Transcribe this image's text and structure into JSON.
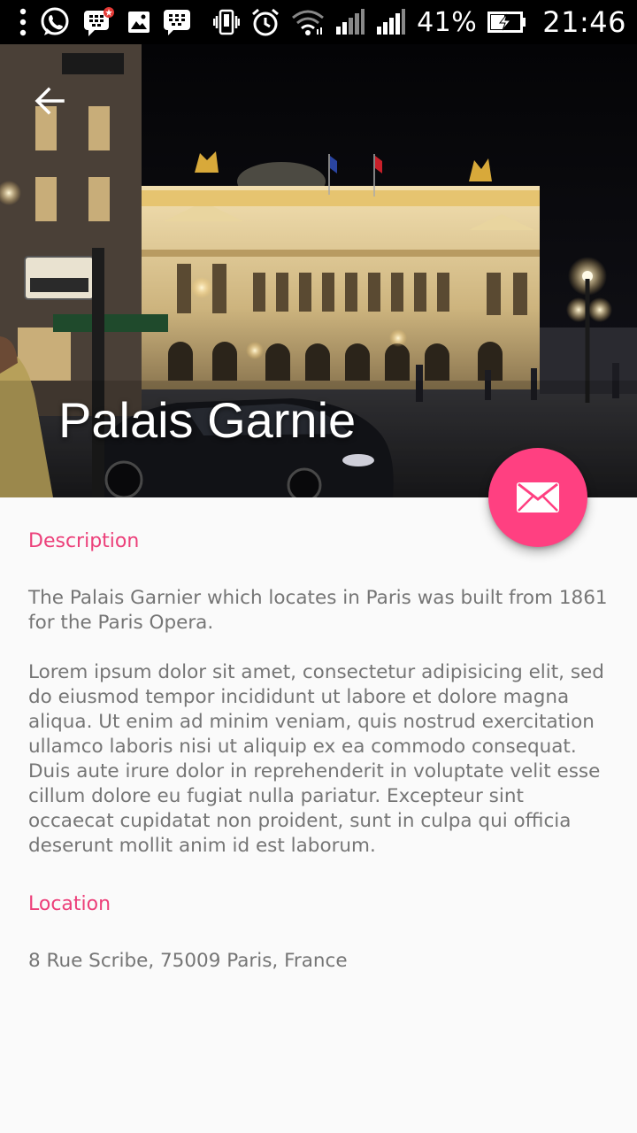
{
  "status_bar": {
    "battery_percent": "41%",
    "time": "21:46",
    "icons": [
      "menu-dots-icon",
      "whatsapp-icon",
      "bbm-notification-icon",
      "gallery-icon",
      "bbm-icon",
      "vibrate-icon",
      "alarm-icon",
      "wifi-icon",
      "signal-sim1-icon",
      "signal-sim2-icon",
      "battery-charging-icon"
    ]
  },
  "hero": {
    "title": "Palais Garnie",
    "back_icon": "arrow-back-icon",
    "image_subject": "palais-garnier-night-photo"
  },
  "fab": {
    "icon": "mail-icon",
    "color": "#ff4081"
  },
  "description": {
    "heading": "Description",
    "intro": "The Palais Garnier which locates in Paris was built from 1861 for the Paris Opera.",
    "body": "Lorem ipsum dolor sit amet, consectetur adipisicing elit, sed do eiusmod tempor incididunt ut labore et dolore magna aliqua. Ut enim ad minim veniam, quis nostrud exercitation ullamco laboris nisi ut aliquip ex ea commodo consequat. Duis aute irure dolor in reprehenderit in voluptate velit esse cillum dolore eu fugiat nulla pariatur. Excepteur sint occaecat cupidatat non proident, sunt in culpa qui officia deserunt mollit anim id est laborum."
  },
  "location": {
    "heading": "Location",
    "address": "8 Rue Scribe, 75009 Paris, France"
  },
  "colors": {
    "accent": "#ec407a",
    "body_text": "#757575",
    "background": "#fafafa"
  }
}
